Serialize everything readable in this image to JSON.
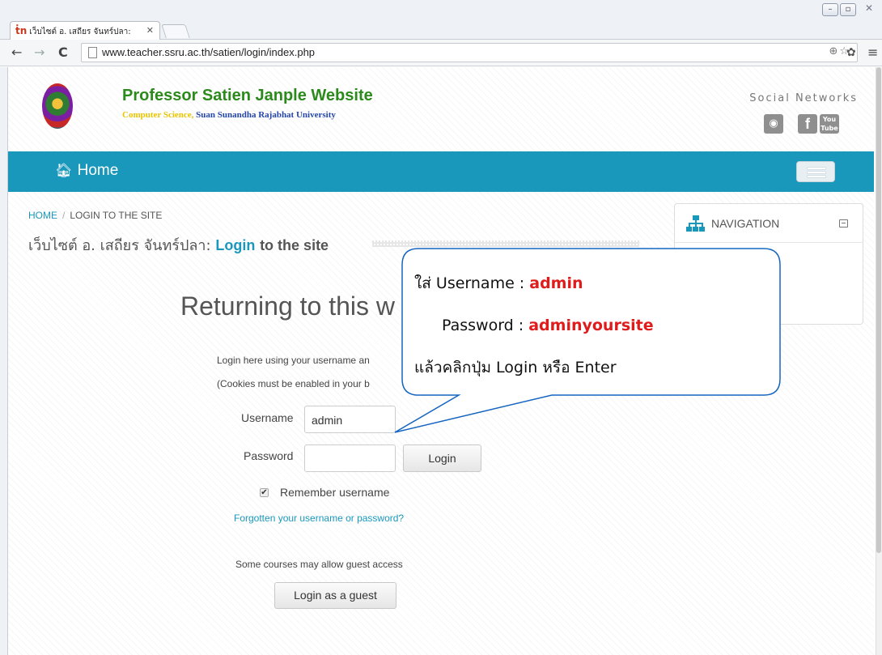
{
  "browser": {
    "tab_title": "เว็บไซต์ อ. เสถียร จันทร์ปลา:",
    "tab_favicon": "ṫn",
    "url": "www.teacher.ssru.ac.th/satien/login/index.php"
  },
  "site": {
    "title": "Professor Satien Janple Website",
    "subtitle_yellow": "Computer Science,",
    "subtitle_blue": "Suan Sunandha Rajabhat University",
    "social_label": "Social Networks",
    "social_icons": [
      "globe-icon",
      "facebook-icon",
      "youtube-icon"
    ],
    "youtube_text_1": "You",
    "youtube_text_2": "Tube"
  },
  "navbar": {
    "home_label": "Home"
  },
  "breadcrumb": {
    "home": "HOME",
    "separator": "/",
    "current": "LOGIN TO THE SITE"
  },
  "heading": {
    "site_name": "เว็บไซต์ อ. เสถียร จันทร์ปลา:",
    "login_word": "Login",
    "rest": "to the site"
  },
  "navigation_block": {
    "title": "NAVIGATION"
  },
  "login_form": {
    "returning_title": "Returning to this w",
    "desc_line1": "Login here using your username an",
    "desc_line2": "(Cookies must be enabled in your b",
    "username_label": "Username",
    "username_value": "admin",
    "password_label": "Password",
    "password_value": "",
    "login_button": "Login",
    "remember_checked": true,
    "remember_label": "Remember username",
    "forgot_link": "Forgotten your username or password?",
    "guest_text": "Some courses may allow guest access",
    "guest_button": "Login as a guest"
  },
  "callout": {
    "line1_prefix": "ใส่ Username : ",
    "line1_value": "admin",
    "line2_prefix": "Password  : ",
    "line2_value": "adminyoursite",
    "line3": "แล้วคลิกปุ่ม Login หรือ Enter"
  },
  "colors": {
    "navbar": "#1a98bb",
    "title_green": "#2c8a1c",
    "callout_border": "#1565c0",
    "callout_red": "#e01b1b"
  }
}
